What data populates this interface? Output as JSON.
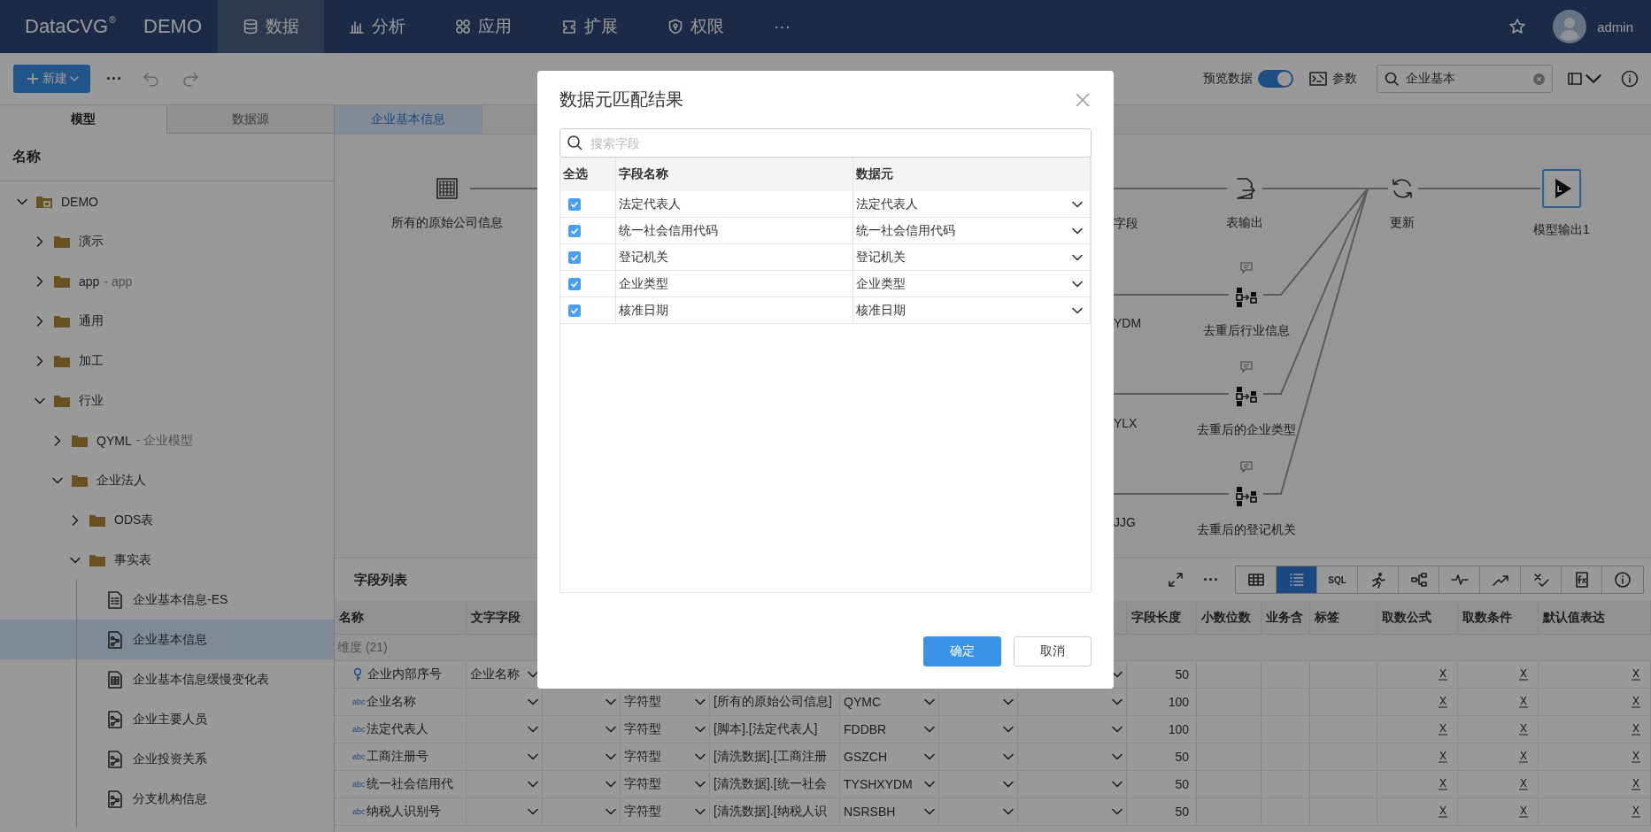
{
  "nav": {
    "logo": "DataCVG",
    "logo_mark": "®",
    "workspace": "DEMO",
    "items": [
      {
        "label": "数据",
        "kind": "database",
        "selected": true
      },
      {
        "label": "分析",
        "kind": "chart",
        "selected": false
      },
      {
        "label": "应用",
        "kind": "apps",
        "selected": false
      },
      {
        "label": "扩展",
        "kind": "extend",
        "selected": false
      },
      {
        "label": "权限",
        "kind": "shield",
        "selected": false
      },
      {
        "label": "···",
        "kind": "more",
        "selected": false
      }
    ],
    "user": "admin"
  },
  "toolbar": {
    "new_button": "新建",
    "more": "···",
    "preview": {
      "label": "预览数据",
      "on": true
    },
    "params": "参数",
    "search": {
      "value": "企业基本"
    }
  },
  "sidebar": {
    "tabs": [
      {
        "label": "模型",
        "selected": true
      },
      {
        "label": "数据源",
        "selected": false
      }
    ],
    "header": "名称",
    "tree": [
      {
        "label": "DEMO",
        "kind": "root",
        "expanded": true,
        "selected": false,
        "children": [
          {
            "label": "演示",
            "kind": "folder",
            "expanded": false,
            "selected": false
          },
          {
            "label": "app",
            "alias": "- app",
            "kind": "folder",
            "expanded": false,
            "selected": false
          },
          {
            "label": "通用",
            "kind": "folder",
            "expanded": false,
            "selected": false
          },
          {
            "label": "加工",
            "kind": "folder",
            "expanded": false,
            "selected": false
          },
          {
            "label": "行业",
            "kind": "folder",
            "expanded": true,
            "selected": false,
            "children": [
              {
                "label": "QYML",
                "alias": "- 企业模型",
                "kind": "folder",
                "expanded": false,
                "selected": false
              },
              {
                "label": "企业法人",
                "kind": "folder",
                "expanded": true,
                "selected": false,
                "children": [
                  {
                    "label": "ODS表",
                    "kind": "folder",
                    "expanded": false,
                    "selected": false
                  },
                  {
                    "label": "事实表",
                    "kind": "folder",
                    "expanded": true,
                    "selected": false,
                    "children": [
                      {
                        "label": "企业基本信息-ES",
                        "kind": "list",
                        "selected": false
                      },
                      {
                        "label": "企业基本信息",
                        "kind": "model",
                        "selected": true
                      },
                      {
                        "label": "企业基本信息缓慢变化表",
                        "kind": "table",
                        "selected": false
                      },
                      {
                        "label": "企业主要人员",
                        "kind": "model",
                        "selected": false
                      },
                      {
                        "label": "企业投资关系",
                        "kind": "model",
                        "selected": false
                      },
                      {
                        "label": "分支机构信息",
                        "kind": "model",
                        "selected": false
                      }
                    ]
                  }
                ]
              }
            ]
          }
        ]
      }
    ]
  },
  "editor_tabs": [
    {
      "label": "企业基本信息",
      "selected": true
    }
  ],
  "flow": {
    "nodes": [
      {
        "kind": "grid",
        "label": "所有的原始公司信息",
        "selected": false
      },
      {
        "kind": "cut",
        "label": "字段"
      },
      {
        "kind": "export",
        "label": "表输出",
        "selected": false
      },
      {
        "kind": "refresh",
        "label": "更新",
        "selected": false
      },
      {
        "kind": "output",
        "label": "模型输出1",
        "selected": true
      },
      {
        "kind": "cut",
        "label": "YDM"
      },
      {
        "kind": "dedup",
        "label": "去重后行业信息",
        "selected": false
      },
      {
        "kind": "cut",
        "label": "YLX"
      },
      {
        "kind": "dedup",
        "label": "去重后的企业类型",
        "selected": false
      },
      {
        "kind": "cut",
        "label": "JJG"
      },
      {
        "kind": "dedup",
        "label": "去重后的登记机关",
        "selected": false
      }
    ]
  },
  "field_panel": {
    "title": "字段列表",
    "more": "···",
    "views": [
      {
        "kind": "table",
        "selected": false
      },
      {
        "kind": "list",
        "selected": true
      },
      {
        "kind": "text",
        "label": "SQL",
        "selected": false
      },
      {
        "kind": "run",
        "selected": false
      },
      {
        "kind": "tree",
        "selected": false
      },
      {
        "kind": "pulse",
        "selected": false
      },
      {
        "kind": "trend",
        "selected": false
      },
      {
        "kind": "check",
        "selected": false
      },
      {
        "kind": "formula",
        "selected": false
      },
      {
        "kind": "info",
        "selected": false
      }
    ],
    "columns": [
      "名称",
      "文字字段",
      "字段长度",
      "小数位数",
      "业务含",
      "标签",
      "取数公式",
      "取数条件",
      "默认值表达"
    ],
    "group": "维度 (21)",
    "rows": [
      {
        "kind": "key",
        "name": "企业内部序号",
        "text_field": "企业名称",
        "length": "50"
      },
      {
        "kind": "abc",
        "badge": "abc",
        "name": "企业名称",
        "type": "字符型",
        "source": "[所有的原始公司信息]",
        "code": "QYMC",
        "length": "100"
      },
      {
        "kind": "abc",
        "badge": "abc",
        "name": "法定代表人",
        "type": "字符型",
        "source": "[脚本].[法定代表人]",
        "code": "FDDBR",
        "length": "100"
      },
      {
        "kind": "abc",
        "badge": "abc",
        "name": "工商注册号",
        "type": "字符型",
        "source": "[清洗数据].[工商注册",
        "code": "GSZCH",
        "length": "50"
      },
      {
        "kind": "abc",
        "badge": "abc",
        "name": "统一社会信用代",
        "type": "字符型",
        "source": "[清洗数据].[统一社会",
        "code": "TYSHXYDM",
        "length": "50"
      },
      {
        "kind": "abc",
        "badge": "abc",
        "name": "纳税人识别号",
        "type": "字符型",
        "source": "[清洗数据].[纳税人识",
        "code": "NSRSBH",
        "length": "50"
      }
    ]
  },
  "dialog": {
    "title": "数据元匹配结果",
    "search": {
      "placeholder": "搜索字段"
    },
    "columns": [
      "全选",
      "字段名称",
      "数据元"
    ],
    "rows": [
      {
        "checked": true,
        "field": "法定代表人",
        "element": "法定代表人"
      },
      {
        "checked": true,
        "field": "统一社会信用代码",
        "element": "统一社会信用代码"
      },
      {
        "checked": true,
        "field": "登记机关",
        "element": "登记机关"
      },
      {
        "checked": true,
        "field": "企业类型",
        "element": "企业类型"
      },
      {
        "checked": true,
        "field": "核准日期",
        "element": "核准日期"
      }
    ],
    "buttons": [
      {
        "label": "确定",
        "kind": "primary"
      },
      {
        "label": "取消",
        "kind": "default"
      }
    ]
  }
}
